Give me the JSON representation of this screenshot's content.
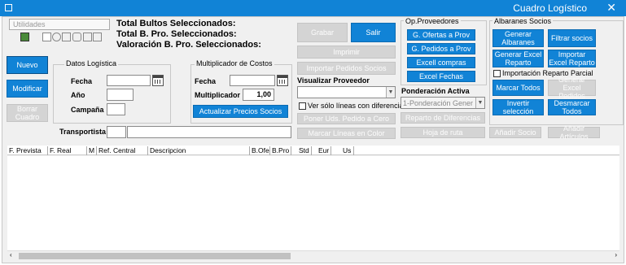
{
  "window": {
    "title": "Cuadro Logístico",
    "close": "✕"
  },
  "toolbar": {
    "tab": "Utilidades"
  },
  "totals": {
    "bultos": "Total Bultos Seleccionados:",
    "bpro": "Total B. Pro. Seleccionados:",
    "valoracion": "Valoración B. Pro. Seleccionados:"
  },
  "left_buttons": {
    "nuevo": "Nuevo",
    "modificar": "Modificar",
    "borrar": "Borrar Cuadro"
  },
  "datos": {
    "title": "Datos Logística",
    "fecha": "Fecha",
    "anio": "Año",
    "campana": "Campaña"
  },
  "multiplicador": {
    "title": "Multiplicador de Costos",
    "fecha": "Fecha",
    "mult_label": "Multiplicador",
    "mult_value": "1,00",
    "actualizar": "Actualizar Precios Socios"
  },
  "transportista": "Transportista",
  "mid_buttons": {
    "grabar": "Grabar",
    "salir": "Salir",
    "imprimir": "Imprimir",
    "importar_pedidos": "Importar Pedidos Socios",
    "poner_uds": "Poner Uds. Pedido a Cero",
    "marcar_lineas": "Marcar Líneas en Color"
  },
  "visualizar": {
    "title": "Visualizar Proveedor",
    "checkbox": "Ver sólo líneas con diferencias"
  },
  "op_proveedores": {
    "title": "Op.Proveedores",
    "ofertas": "G. Ofertas a Prov",
    "pedidos": "G. Pedidos a Prov",
    "excell_compras": "Excell compras",
    "excel_fechas": "Excel Fechas"
  },
  "ponderacion": {
    "title": "Ponderación Activa",
    "selected": "1-Ponderación Gener",
    "reparto": "Reparto de Diferencias",
    "hoja": "Hoja de ruta"
  },
  "albaranes": {
    "title": "Albaranes Socios",
    "generar": "Generar Albaranes",
    "filtrar": "Filtrar socios",
    "generar_excel": "Generar Excel Reparto",
    "importar_excel": "Importar Excel Reparto",
    "importacion_parcial": "Importación Reparto Parcial",
    "marcar_todos": "Marcar Todos",
    "generar_excel_pedidos": "Generar Excel Pedidos",
    "invertir": "Invertir selección",
    "desmarcar": "Desmarcar Todos",
    "anadir_socio": "Añadir Socio",
    "anadir_articulos": "Añadir Artículos"
  },
  "columns": [
    "F. Prevista",
    "F. Real",
    "M",
    "Ref. Central",
    "Descripcion",
    "B.Ofe",
    "B.Pro",
    "Std",
    "Eur",
    "Us"
  ],
  "colors": {
    "accent": "#1183d6",
    "disabled": "#d4d4d4",
    "window": "#f0f0f0"
  }
}
